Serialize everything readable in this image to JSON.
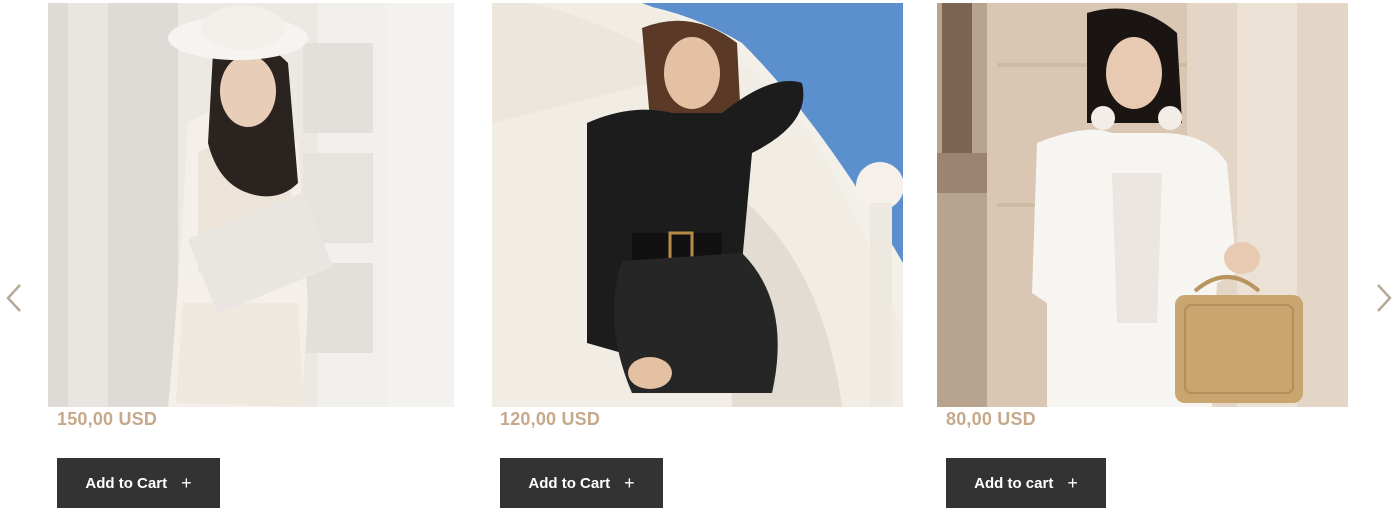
{
  "colors": {
    "price": "#c6a98a",
    "button_bg": "#333333",
    "button_text": "#ffffff",
    "arrow": "#b8a896"
  },
  "navigation": {
    "prev_icon": "chevron-left-icon",
    "next_icon": "chevron-right-icon"
  },
  "products": [
    {
      "price": "150,00 USD",
      "button_label": "Add to Cart",
      "button_icon": "plus-icon"
    },
    {
      "price": "120,00 USD",
      "button_label": "Add to Cart",
      "button_icon": "plus-icon"
    },
    {
      "price": "80,00 USD",
      "button_label": "Add to cart",
      "button_icon": "plus-icon"
    }
  ]
}
